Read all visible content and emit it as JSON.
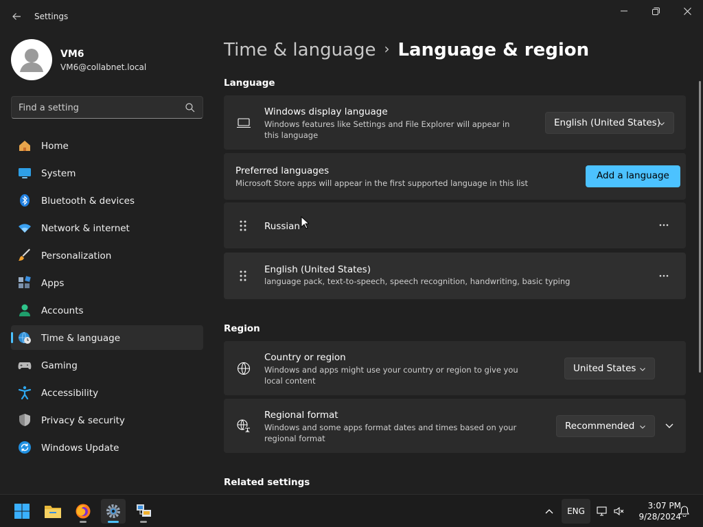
{
  "window": {
    "title": "Settings"
  },
  "profile": {
    "name": "VM6",
    "email": "VM6@collabnet.local"
  },
  "search": {
    "placeholder": "Find a setting"
  },
  "sidebar": {
    "items": [
      {
        "label": "Home",
        "icon": "home-icon"
      },
      {
        "label": "System",
        "icon": "system-icon"
      },
      {
        "label": "Bluetooth & devices",
        "icon": "bluetooth-icon"
      },
      {
        "label": "Network & internet",
        "icon": "wifi-icon"
      },
      {
        "label": "Personalization",
        "icon": "brush-icon"
      },
      {
        "label": "Apps",
        "icon": "apps-icon"
      },
      {
        "label": "Accounts",
        "icon": "accounts-icon"
      },
      {
        "label": "Time & language",
        "icon": "globe-clock-icon",
        "active": true
      },
      {
        "label": "Gaming",
        "icon": "gamepad-icon"
      },
      {
        "label": "Accessibility",
        "icon": "accessibility-icon"
      },
      {
        "label": "Privacy & security",
        "icon": "shield-icon"
      },
      {
        "label": "Windows Update",
        "icon": "update-icon"
      }
    ]
  },
  "breadcrumb": {
    "parent": "Time & language",
    "separator": "›",
    "current": "Language & region"
  },
  "language": {
    "section_title": "Language",
    "display_language": {
      "title": "Windows display language",
      "description": "Windows features like Settings and File Explorer will appear in this language",
      "value": "English (United States)"
    },
    "preferred": {
      "title": "Preferred languages",
      "description": "Microsoft Store apps will appear in the first supported language in this list",
      "add_button": "Add a language"
    },
    "languages": [
      {
        "name": "Russian",
        "details": ""
      },
      {
        "name": "English (United States)",
        "details": "language pack, text-to-speech, speech recognition, handwriting, basic typing"
      }
    ],
    "more_label": "···"
  },
  "region": {
    "section_title": "Region",
    "country": {
      "title": "Country or region",
      "description": "Windows and apps might use your country or region to give you local content",
      "value": "United States"
    },
    "format": {
      "title": "Regional format",
      "description": "Windows and some apps format dates and times based on your regional format",
      "value": "Recommended"
    }
  },
  "related": {
    "section_title": "Related settings"
  },
  "taskbar": {
    "input_language": "ENG",
    "time": "3:07 PM",
    "date": "9/28/2024"
  },
  "colors": {
    "accent": "#4cc2ff",
    "background": "#202020",
    "card": "#2b2b2b"
  }
}
